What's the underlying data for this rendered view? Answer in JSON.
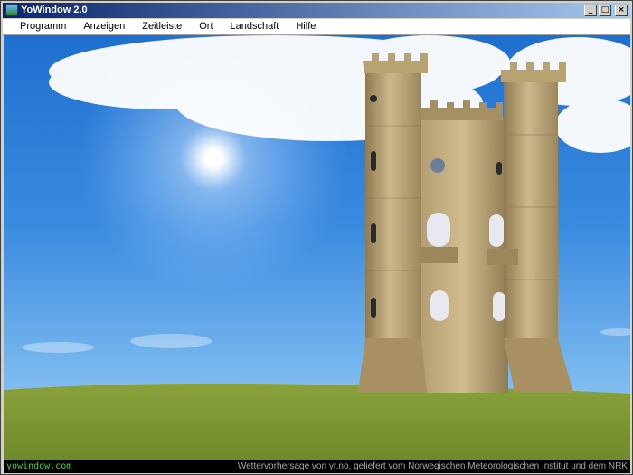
{
  "window": {
    "title": "YoWindow 2.0",
    "minimize_glyph": "_",
    "maximize_glyph": "□",
    "close_glyph": "×"
  },
  "menu": {
    "items": [
      "Programm",
      "Anzeigen",
      "Zeitleiste",
      "Ort",
      "Landschaft",
      "Hilfe"
    ]
  },
  "status": {
    "brand": "yowindow.com",
    "credit": "Wettervorhersage von yr.no, geliefert vom Norwegischen Meteorologischen Institut und dem NRK"
  },
  "colors": {
    "sky_top": "#1f6fd0",
    "grass": "#7f9a35",
    "tower_stone": "#c8b185",
    "brand_green": "#3fd13f"
  },
  "icons": {
    "app": "yowindow-app-icon",
    "minimize": "minimize-icon",
    "maximize": "maximize-icon",
    "close": "close-icon"
  }
}
